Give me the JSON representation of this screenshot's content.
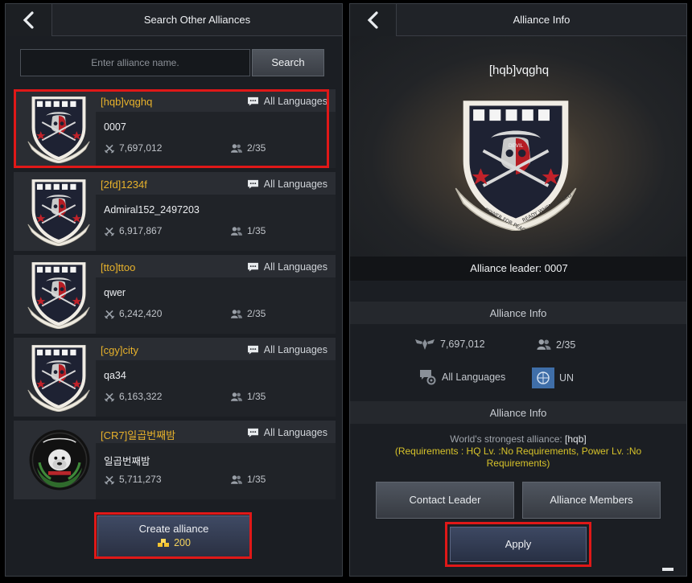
{
  "search_screen": {
    "title": "Search Other Alliances",
    "back_icon": "chevron-left-icon",
    "search": {
      "placeholder": "Enter alliance name.",
      "value": "",
      "button_label": "Search"
    },
    "alliances": [
      {
        "name": "[hqb]vqghq",
        "language": "All Languages",
        "leader": "0007",
        "power": "7,697,012",
        "members": "2/35",
        "emblem": "devil-shield-emblem",
        "highlighted": true
      },
      {
        "name": "[2fd]1234f",
        "language": "All Languages",
        "leader": "Admiral152_2497203",
        "power": "6,917,867",
        "members": "1/35",
        "emblem": "devil-shield-emblem",
        "highlighted": false
      },
      {
        "name": "[tto]ttoo",
        "language": "All Languages",
        "leader": "qwer",
        "power": "6,242,420",
        "members": "2/35",
        "emblem": "devil-shield-emblem",
        "highlighted": false
      },
      {
        "name": "[cgy]city",
        "language": "All Languages",
        "leader": "qa34",
        "power": "6,163,322",
        "members": "1/35",
        "emblem": "devil-shield-emblem",
        "highlighted": false
      },
      {
        "name": "[CR7]일곱번째밤",
        "language": "All Languages",
        "leader": "일곱번째밤",
        "power": "5,711,273",
        "members": "1/35",
        "emblem": "bulldog-round-emblem",
        "highlighted": false
      }
    ],
    "create_button": {
      "label": "Create alliance",
      "cost": "200",
      "cost_icon": "gold-bars-icon"
    }
  },
  "info_screen": {
    "title": "Alliance Info",
    "alliance_name": "[hqb]vqghq",
    "emblem_motto_left": "POWER FOR PEACE",
    "emblem_motto_right": "READY WHEN CALLED",
    "emblem_badge": "DEVIL",
    "leader_label": "Alliance leader: 0007",
    "info_heading": "Alliance Info",
    "stats": {
      "power": "7,697,012",
      "members": "2/35",
      "language": "All Languages",
      "region": "UN"
    },
    "description_heading": "Alliance Info",
    "description_prefix": "World's strongest alliance: ",
    "description_tag": "[hqb]",
    "requirements": "(Requirements : HQ Lv. :No Requirements, Power Lv. :No Requirements)",
    "buttons": {
      "contact": "Contact Leader",
      "members": "Alliance Members",
      "apply": "Apply"
    }
  },
  "colors": {
    "alliance_name": "#e8b22b",
    "highlight": "#e01818",
    "requirements": "#d6c22a",
    "panel_bg": "#1b1e23"
  }
}
